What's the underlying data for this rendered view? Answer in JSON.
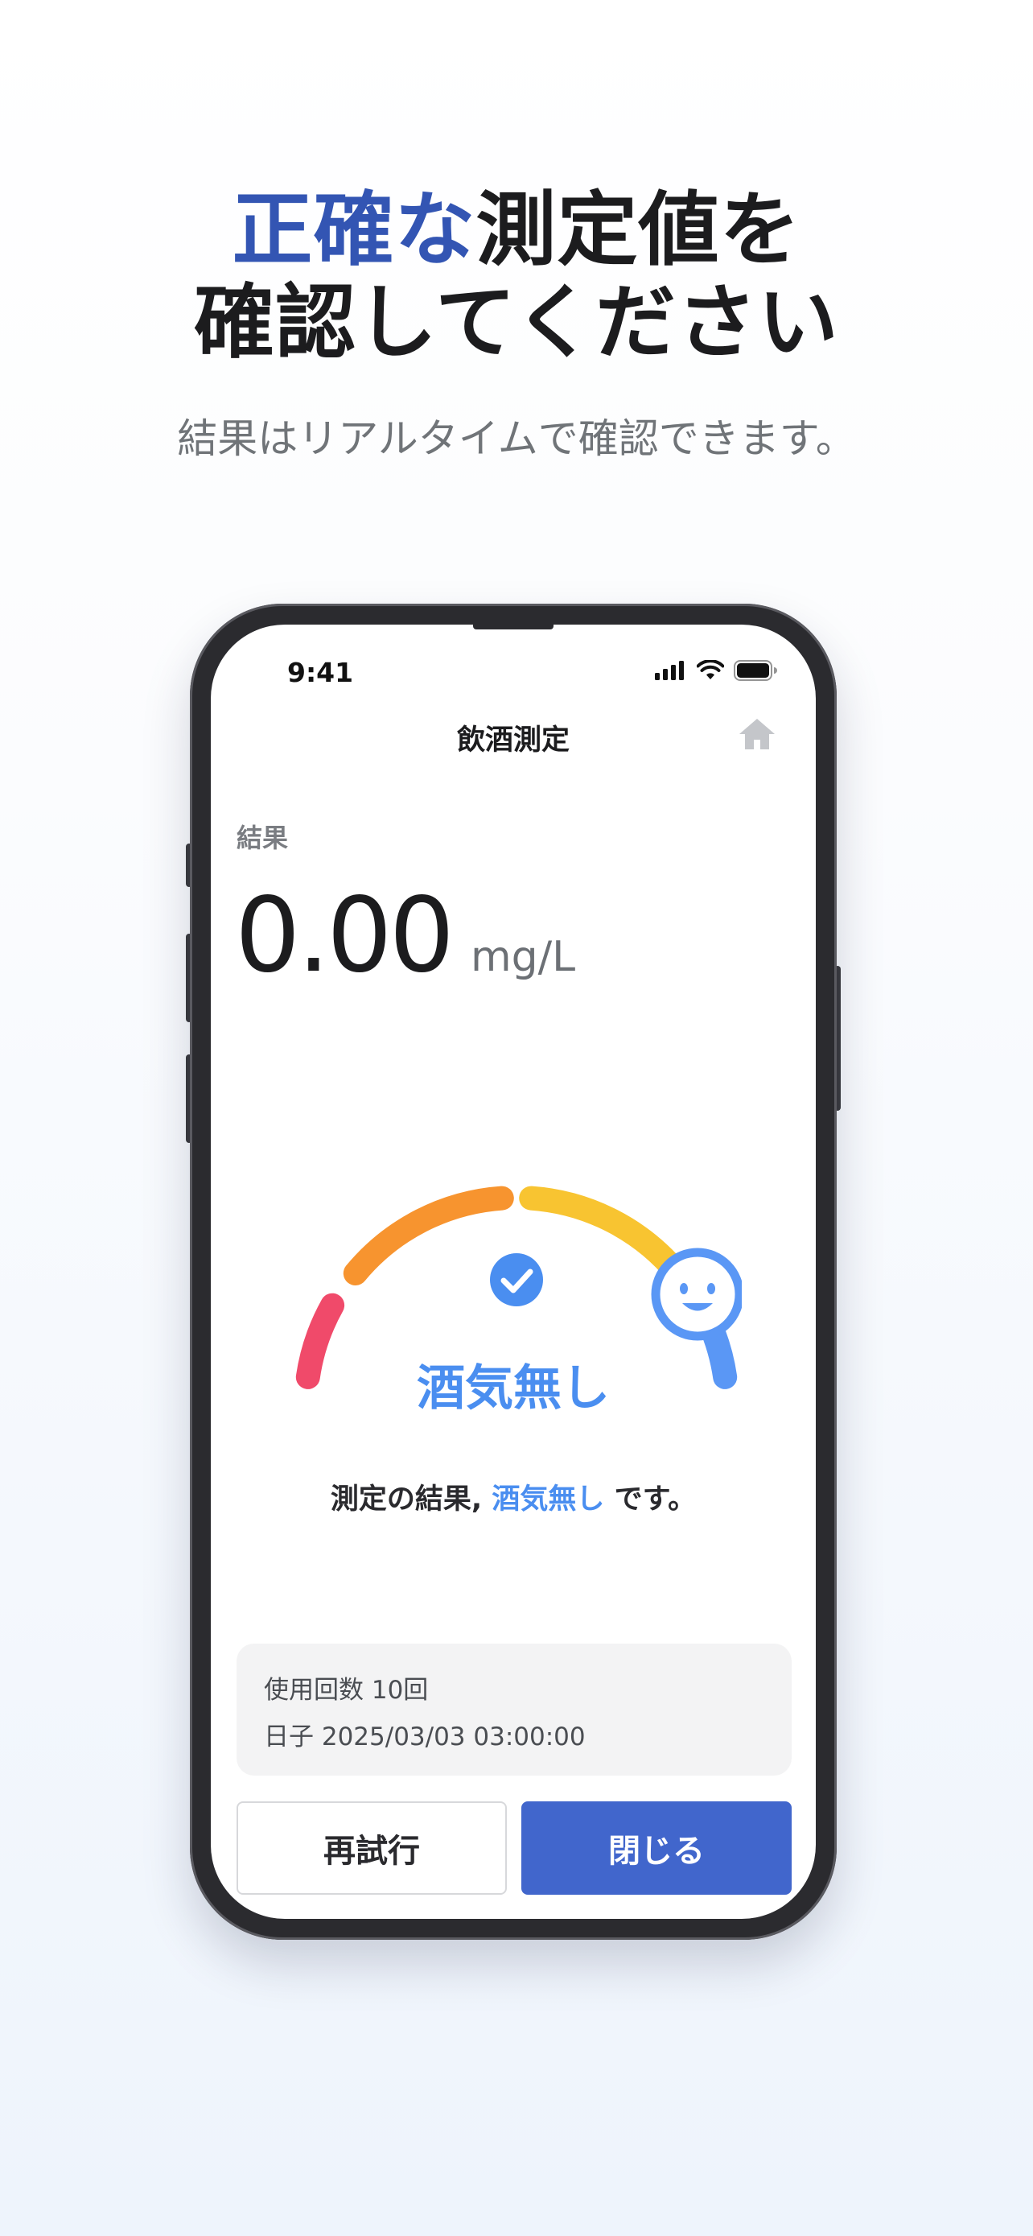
{
  "headline": {
    "accent": "正確な",
    "line1_rest": "測定値を",
    "line2": "確認してください"
  },
  "subhead": "結果はリアルタイムで確認できます。",
  "status_bar": {
    "time": "9:41"
  },
  "nav": {
    "title": "飲酒測定",
    "home_icon": "home-icon"
  },
  "result": {
    "label": "結果",
    "value": "0.00",
    "unit": "mg/L"
  },
  "gauge": {
    "status": "酒気無し",
    "colors": {
      "red": "#f04a6a",
      "orange": "#f7942f",
      "yellow": "#f8c431",
      "blue": "#5a97f5"
    }
  },
  "summary": {
    "prefix": "測定の結果,",
    "highlight": "酒気無し",
    "suffix": "です。"
  },
  "info": {
    "usage": "使用回数 10回",
    "date": "日子 2025/03/03 03:00:00"
  },
  "buttons": {
    "retry": "再試行",
    "close": "閉じる"
  },
  "colors": {
    "accent": "#3355b3",
    "primary_button": "#4166cc",
    "status_blue": "#4a8ef0"
  }
}
